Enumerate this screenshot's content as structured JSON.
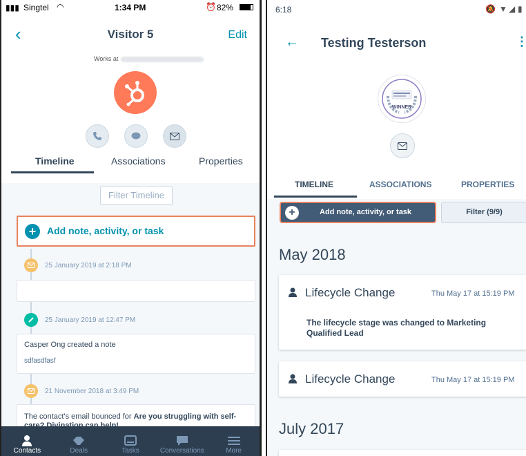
{
  "ios": {
    "status": {
      "carrier": "Singtel",
      "time": "1:34 PM",
      "battery": "82%"
    },
    "header": {
      "title": "Visitor 5",
      "edit_label": "Edit",
      "works_at": "Works at"
    },
    "tabs": [
      {
        "label": "Timeline"
      },
      {
        "label": "Associations"
      },
      {
        "label": "Properties"
      }
    ],
    "filter_label": "Filter Timeline",
    "add_label": "Add note, activity, or task",
    "timeline": [
      {
        "date": "25 January 2019 at 2:18 PM",
        "type": "email"
      },
      {
        "date": "25 January 2019 at 12:47 PM",
        "type": "note",
        "author": "Casper Ong",
        "action": "created a note",
        "body": "sdfasdfasf"
      },
      {
        "date": "21 November 2018 at 3:49 PM",
        "type": "email",
        "body_prefix": "The contact's email bounced for",
        "body_bold": "Are you struggling with self-care? Divination can help!"
      }
    ],
    "nav": [
      {
        "label": "Contacts",
        "icon": "person-icon"
      },
      {
        "label": "Deals",
        "icon": "handshake-icon"
      },
      {
        "label": "Tasks",
        "icon": "tasks-icon"
      },
      {
        "label": "Conversations",
        "icon": "chat-icon"
      },
      {
        "label": "More",
        "icon": "menu-icon"
      }
    ]
  },
  "android": {
    "status": {
      "time": "6:18"
    },
    "header": {
      "title": "Testing Testerson"
    },
    "avatar_text": "WINNER",
    "tabs": [
      {
        "label": "TIMELINE"
      },
      {
        "label": "ASSOCIATIONS"
      },
      {
        "label": "PROPERTIES"
      }
    ],
    "add_label": "Add note, activity, or task",
    "filter_label": "Filter (9/9)",
    "months": [
      "May 2018",
      "July 2017"
    ],
    "events": [
      {
        "title": "Lifecycle Change",
        "date": "Thu May 17 at 15:19 PM",
        "body": "The lifecycle stage was changed to Marketing Qualified Lead"
      },
      {
        "title": "Lifecycle Change",
        "date": "Thu May 17 at 15:19 PM"
      }
    ]
  },
  "colors": {
    "accent": "#0091ae",
    "highlight": "#e9825e",
    "brand": "#ff7a59",
    "nav": "#2d3e50"
  }
}
